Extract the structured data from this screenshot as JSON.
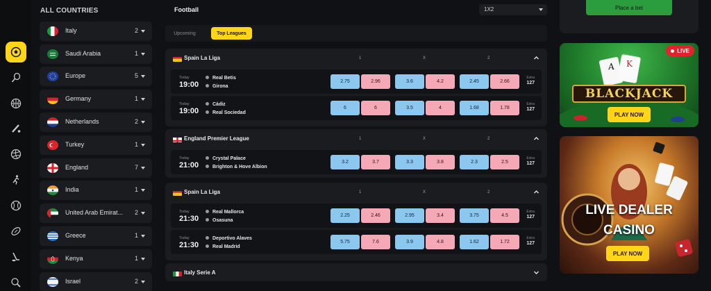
{
  "sidebar_rail": {
    "icons": [
      {
        "name": "football",
        "active": true
      },
      {
        "name": "tennis",
        "active": false
      },
      {
        "name": "basketball",
        "active": false
      },
      {
        "name": "cricket",
        "active": false
      },
      {
        "name": "volleyball",
        "active": false
      },
      {
        "name": "runner",
        "active": false
      },
      {
        "name": "baseball",
        "active": false
      },
      {
        "name": "rugby",
        "active": false
      },
      {
        "name": "hockey",
        "active": false
      },
      {
        "name": "table-tennis",
        "active": false
      }
    ]
  },
  "countries": {
    "title": "ALL COUNTRIES",
    "items": [
      {
        "name": "Italy",
        "count": "2"
      },
      {
        "name": "Saudi Arabia",
        "count": "1"
      },
      {
        "name": "Europe",
        "count": "5"
      },
      {
        "name": "Germany",
        "count": "1"
      },
      {
        "name": "Netherlands",
        "count": "2"
      },
      {
        "name": "Turkey",
        "count": "1"
      },
      {
        "name": "England",
        "count": "7"
      },
      {
        "name": "India",
        "count": "1"
      },
      {
        "name": "United Arab Emirat...",
        "count": "2"
      },
      {
        "name": "Greece",
        "count": "1"
      },
      {
        "name": "Kenya",
        "count": "1"
      },
      {
        "name": "Israel",
        "count": "2"
      }
    ]
  },
  "main": {
    "sport_title": "Football",
    "market_select": "1X2",
    "tabs": [
      {
        "label": "Upcoming",
        "active": false
      },
      {
        "label": "Top Leagues",
        "active": true
      }
    ],
    "col_labels": {
      "home": "1",
      "draw": "X",
      "away": "2"
    },
    "leagues": [
      {
        "name": "Spain La Liga",
        "expanded": true,
        "matches": [
          {
            "day": "Today",
            "time": "19:00",
            "home": "Real Betis",
            "away": "Girona",
            "odds": [
              "2.75",
              "2.96",
              "3.6",
              "4.2",
              "2.45",
              "2.66"
            ],
            "extra_label": "Extra",
            "extra": "127"
          },
          {
            "day": "Today",
            "time": "19:00",
            "home": "Cádiz",
            "away": "Real Sociedad",
            "odds": [
              "6",
              "6",
              "3.5",
              "4",
              "1.68",
              "1.78"
            ],
            "extra_label": "Extra",
            "extra": "127"
          }
        ]
      },
      {
        "name": "England Premier League",
        "expanded": true,
        "matches": [
          {
            "day": "Today",
            "time": "21:00",
            "home": "Crystal Palace",
            "away": "Brighton & Hove Albion",
            "odds": [
              "3.2",
              "3.7",
              "3.3",
              "3.8",
              "2.3",
              "2.5"
            ],
            "extra_label": "Extra",
            "extra": "127"
          }
        ]
      },
      {
        "name": "Spain La Liga",
        "expanded": true,
        "matches": [
          {
            "day": "Today",
            "time": "21:30",
            "home": "Real Mallorca",
            "away": "Osasuna",
            "odds": [
              "2.25",
              "2.46",
              "2.95",
              "3.4",
              "3.75",
              "4.5"
            ],
            "extra_label": "Extra",
            "extra": "127"
          },
          {
            "day": "Today",
            "time": "21:30",
            "home": "Deportivo Alaves",
            "away": "Real Madrid",
            "odds": [
              "5.75",
              "7.6",
              "3.9",
              "4.8",
              "1.62",
              "1.72"
            ],
            "extra_label": "Extra",
            "extra": "127"
          }
        ]
      },
      {
        "name": "Italy Serie A",
        "expanded": false,
        "matches": []
      }
    ]
  },
  "right": {
    "place_bet": "Place a bet",
    "blackjack": {
      "live": "LIVE",
      "title": "BLACKJACK",
      "cta": "PLAY NOW"
    },
    "live_dealer": {
      "title_line1": "LIVE DEALER",
      "title_line2": "CASINO",
      "cta": "PLAY NOW"
    }
  },
  "colors": {
    "accent": "#ffd51a",
    "odd_blue": "#8cc7f0",
    "odd_pink": "#f5a9b6",
    "live_red": "#e3232b",
    "bet_green": "#2c9d3f"
  }
}
